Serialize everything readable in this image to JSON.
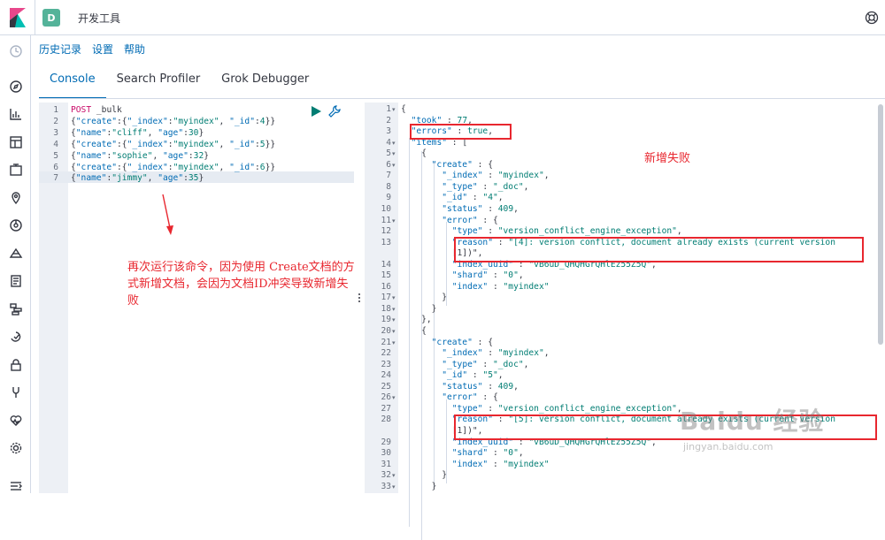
{
  "header": {
    "space_initial": "D",
    "app_title": "开发工具"
  },
  "nav_icons": [
    "clock-icon",
    "compass-icon",
    "chart-icon",
    "dashboard-icon",
    "canvas-icon",
    "maps-icon",
    "ml-icon",
    "infra-icon",
    "logs-icon",
    "apm-icon",
    "uptime-icon",
    "security-icon",
    "devtools-icon",
    "monitoring-icon",
    "management-icon",
    "collapse-icon"
  ],
  "menu": {
    "history": "历史记录",
    "settings": "设置",
    "help": "帮助"
  },
  "tabs": [
    "Console",
    "Search Profiler",
    "Grok Debugger"
  ],
  "editor": {
    "lines": [
      {
        "n": "1",
        "text": "POST _bulk"
      },
      {
        "n": "2",
        "text": "{\"create\":{\"_index\":\"myindex\", \"_id\":4}}"
      },
      {
        "n": "3",
        "text": "{\"name\":\"cliff\", \"age\":30}"
      },
      {
        "n": "4",
        "text": "{\"create\":{\"_index\":\"myindex\", \"_id\":5}}"
      },
      {
        "n": "5",
        "text": "{\"name\":\"sophie\", \"age\":32}"
      },
      {
        "n": "6",
        "text": "{\"create\":{\"_index\":\"myindex\", \"_id\":6}}"
      },
      {
        "n": "7",
        "text": "{\"name\":\"jimmy\", \"age\":35}"
      }
    ]
  },
  "annotation": "再次运行该命令，因为使用 Create文档的方式新增文档，会因为文档ID冲突导致新增失败",
  "fail_label": "新增失败",
  "output": {
    "lines": [
      {
        "n": "1",
        "text": "{"
      },
      {
        "n": "2",
        "text": "  \"took\" : 77,"
      },
      {
        "n": "3",
        "text": "  \"errors\" : true,"
      },
      {
        "n": "4",
        "text": "  \"items\" : ["
      },
      {
        "n": "5",
        "text": "    {"
      },
      {
        "n": "6",
        "text": "      \"create\" : {"
      },
      {
        "n": "7",
        "text": "        \"_index\" : \"myindex\","
      },
      {
        "n": "8",
        "text": "        \"_type\" : \"_doc\","
      },
      {
        "n": "9",
        "text": "        \"_id\" : \"4\","
      },
      {
        "n": "10",
        "text": "        \"status\" : 409,"
      },
      {
        "n": "11",
        "text": "        \"error\" : {"
      },
      {
        "n": "12",
        "text": "          \"type\" : \"version_conflict_engine_exception\","
      },
      {
        "n": "13",
        "text": "          \"reason\" : \"[4]: version conflict, document already exists (current version"
      },
      {
        "n": "",
        "text": "          [1])\","
      },
      {
        "n": "14",
        "text": "          \"index_uuid\" : \"vB6uD_QHQHGrQHlEz55Z5Q\","
      },
      {
        "n": "15",
        "text": "          \"shard\" : \"0\","
      },
      {
        "n": "16",
        "text": "          \"index\" : \"myindex\""
      },
      {
        "n": "17",
        "text": "        }"
      },
      {
        "n": "18",
        "text": "      }"
      },
      {
        "n": "19",
        "text": "    },"
      },
      {
        "n": "20",
        "text": "    {"
      },
      {
        "n": "21",
        "text": "      \"create\" : {"
      },
      {
        "n": "22",
        "text": "        \"_index\" : \"myindex\","
      },
      {
        "n": "23",
        "text": "        \"_type\" : \"_doc\","
      },
      {
        "n": "24",
        "text": "        \"_id\" : \"5\","
      },
      {
        "n": "25",
        "text": "        \"status\" : 409,"
      },
      {
        "n": "26",
        "text": "        \"error\" : {"
      },
      {
        "n": "27",
        "text": "          \"type\" : \"version_conflict_engine_exception\","
      },
      {
        "n": "28",
        "text": "          \"reason\" : \"[5]: version conflict, document already exists (current version"
      },
      {
        "n": "",
        "text": "          [1])\","
      },
      {
        "n": "29",
        "text": "          \"index_uuid\" : \"vB6uD_QHQHGrQHlEz55Z5Q\","
      },
      {
        "n": "30",
        "text": "          \"shard\" : \"0\","
      },
      {
        "n": "31",
        "text": "          \"index\" : \"myindex\""
      },
      {
        "n": "32",
        "text": "        }"
      },
      {
        "n": "33",
        "text": "      }"
      }
    ]
  },
  "watermark": {
    "title": "Baidu 经验",
    "url": "jingyan.baidu.com"
  }
}
